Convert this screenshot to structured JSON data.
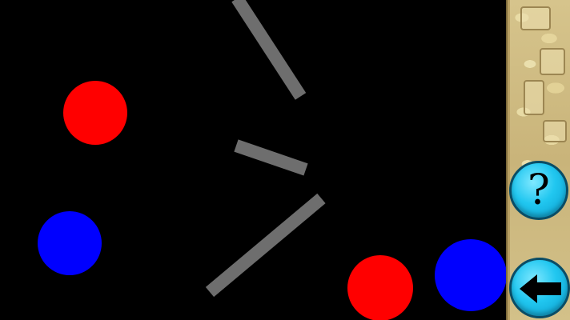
{
  "game": {
    "background_color": "#000000",
    "balls": [
      {
        "name": "red-ball",
        "color": "#ff0000"
      },
      {
        "name": "blue-ball",
        "color": "#0000ff"
      },
      {
        "name": "red-ball",
        "color": "#ff0000"
      },
      {
        "name": "blue-ball",
        "color": "#0000ff"
      }
    ],
    "plank_color": "#6e6e6e",
    "plank_count": 3
  },
  "side_panel": {
    "texture": "stone-glyph-wall",
    "help_button": {
      "label": "?",
      "icon": "question-mark-icon",
      "color": "#21c7f0"
    },
    "back_button": {
      "icon": "arrow-left-icon",
      "color": "#21c7f0"
    }
  }
}
